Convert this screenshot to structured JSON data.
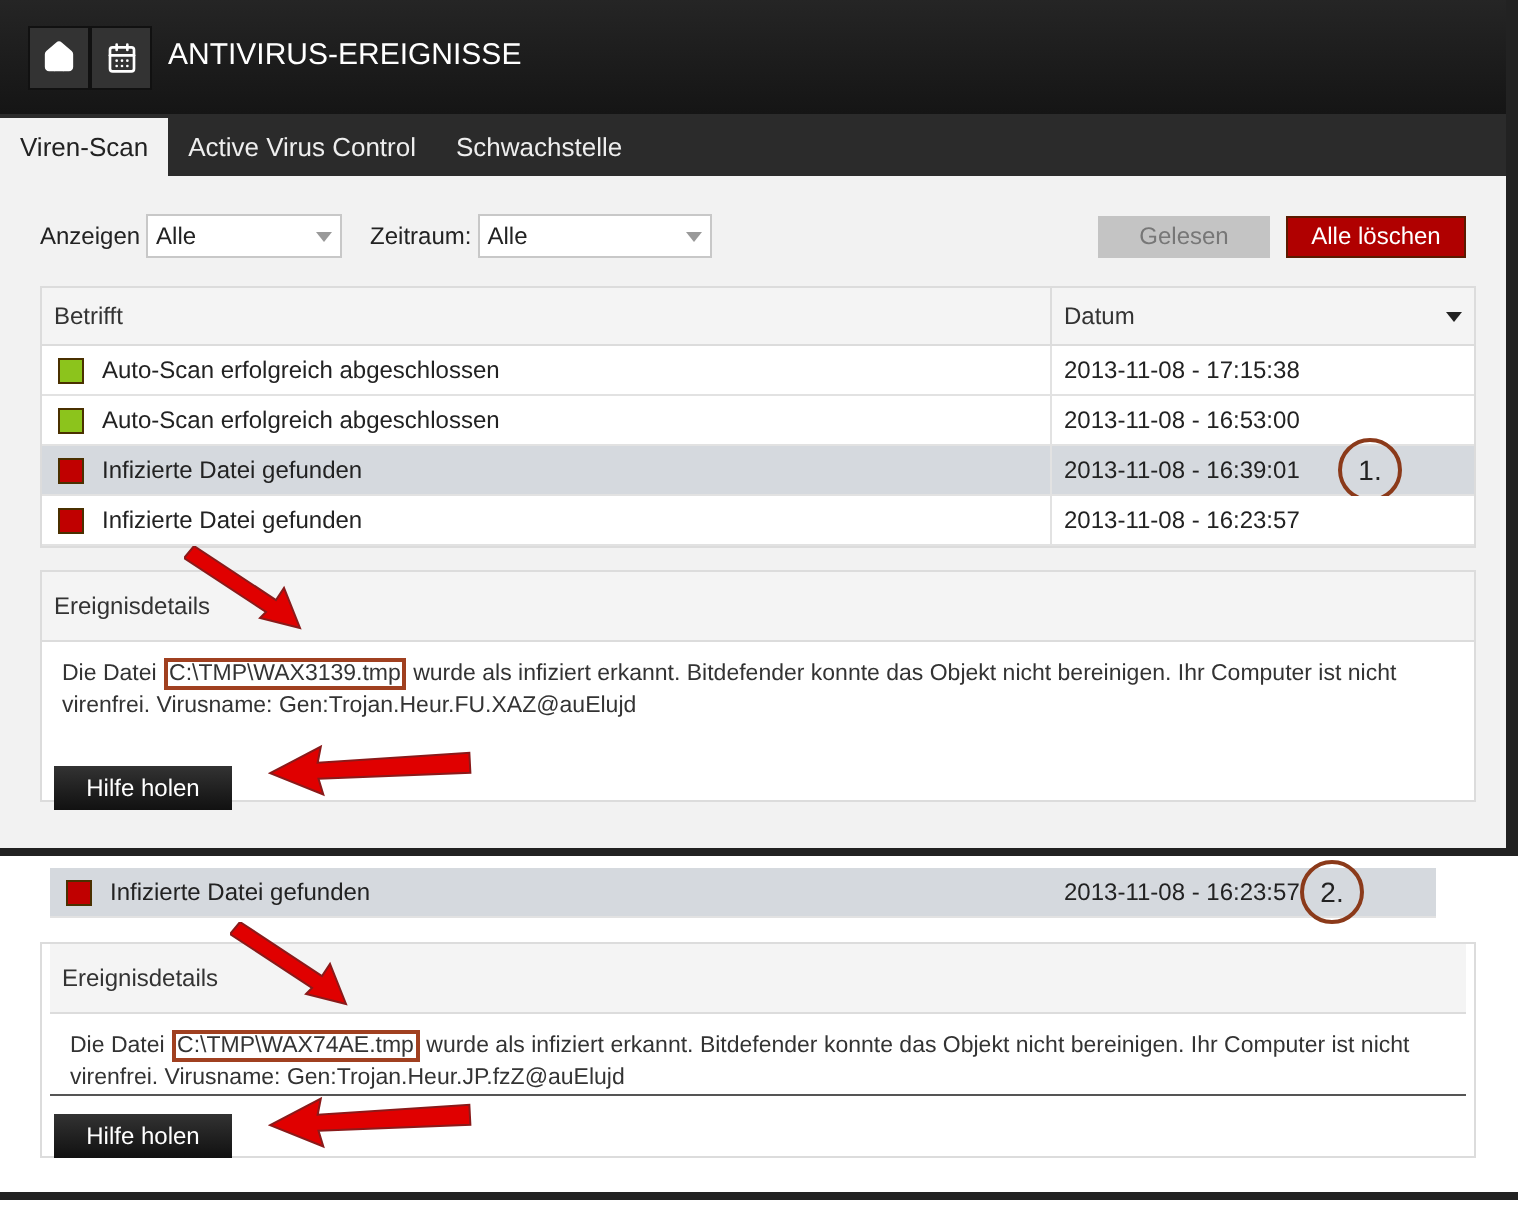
{
  "header": {
    "title": "ANTIVIRUS-EREIGNISSE"
  },
  "tabs": [
    {
      "label": "Viren-Scan",
      "selected": true
    },
    {
      "label": "Active Virus Control",
      "selected": false
    },
    {
      "label": "Schwachstelle",
      "selected": false
    }
  ],
  "filters": [
    {
      "label": "Anzeigen",
      "value": "Alle"
    },
    {
      "label": "Zeitraum:",
      "value": "Alle"
    }
  ],
  "buttons": [
    {
      "label": "Gelesen",
      "disabled": true
    },
    {
      "label": "Alle löschen",
      "disabled": false
    }
  ],
  "table": {
    "columns": [
      "Betrifft",
      "Datum"
    ],
    "rows": [
      {
        "color": "#8cc41c",
        "subject": "Auto-Scan erfolgreich abgeschlossen",
        "date": "2013-11-08 - 17:15:38",
        "selected": false
      },
      {
        "color": "#8cc41c",
        "subject": "Auto-Scan erfolgreich abgeschlossen",
        "date": "2013-11-08 - 16:53:00",
        "selected": false
      },
      {
        "color": "#c00000",
        "subject": "Infizierte Datei gefunden",
        "date": "2013-11-08 - 16:39:01",
        "selected": true,
        "callout": "1."
      },
      {
        "color": "#c00000",
        "subject": "Infizierte Datei gefunden",
        "date": "2013-11-08 - 16:23:57",
        "selected": false
      }
    ]
  },
  "details": {
    "title": "Ereignisdetails",
    "text_before": "Die Datei",
    "file_path": "C:\\TMP\\WAX3139.tmp",
    "text_after": "wurde als infiziert erkannt. Bitdefender konnte das Objekt nicht bereinigen. Ihr Computer ist nicht virenfrei. Virusname: Gen:Trojan.Heur.FU.XAZ@auElujd",
    "button": "Hilfe holen"
  },
  "second_excerpt": {
    "row": {
      "color": "#c00000",
      "subject": "Infizierte Datei gefunden",
      "date": "2013-11-08 - 16:23:57",
      "selected": true,
      "callout": "2."
    },
    "details": {
      "title": "Ereignisdetails",
      "text_before": "Die Datei",
      "file_path": "C:\\TMP\\WAX74AE.tmp",
      "text_after": "wurde als infiziert erkannt. Bitdefender konnte das Objekt nicht bereinigen. Ihr Computer ist nicht virenfrei. Virusname: Gen:Trojan.Heur.JP.fzZ@auElujd",
      "button": "Hilfe holen"
    }
  }
}
